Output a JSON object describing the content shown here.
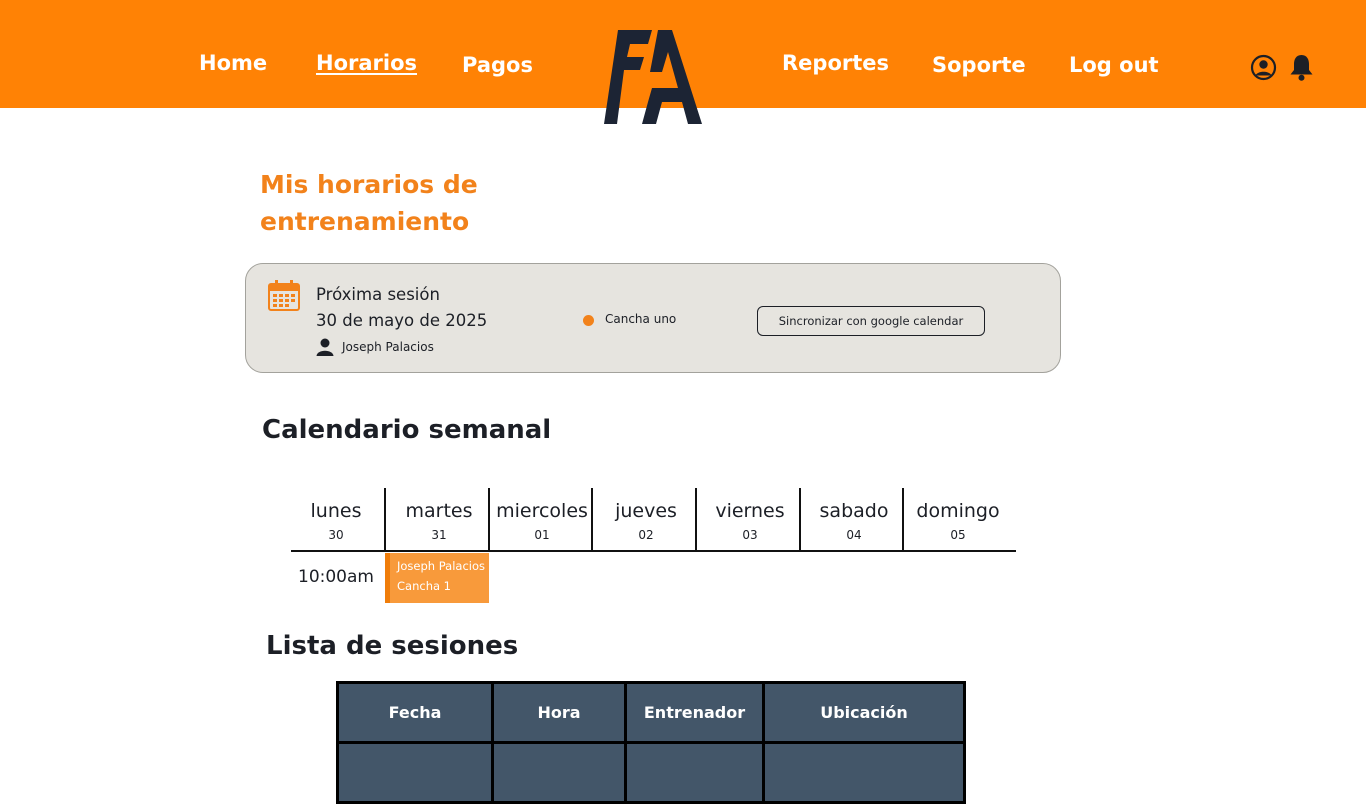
{
  "nav": {
    "home": "Home",
    "horarios": "Horarios",
    "pagos": "Pagos",
    "reportes": "Reportes",
    "soporte": "Soporte",
    "logout": "Log out"
  },
  "page": {
    "title": "Mis horarios de entrenamiento"
  },
  "next_session": {
    "label": "Próxima sesión",
    "date": "30 de mayo de 2025",
    "coach": "Joseph Palacios",
    "location": "Cancha uno",
    "sync_button": "Sincronizar con google calendar"
  },
  "calendar": {
    "title": "Calendario semanal",
    "days": [
      {
        "name": "lunes",
        "num": "30"
      },
      {
        "name": "martes",
        "num": "31"
      },
      {
        "name": "miercoles",
        "num": "01"
      },
      {
        "name": "jueves",
        "num": "02"
      },
      {
        "name": "viernes",
        "num": "03"
      },
      {
        "name": "sabado",
        "num": "04"
      },
      {
        "name": "domingo",
        "num": "05"
      }
    ],
    "time_slot": "10:00am",
    "event": {
      "coach": "Joseph Palacios",
      "location": "Cancha 1"
    }
  },
  "sessions": {
    "title": "Lista de sesiones",
    "columns": [
      "Fecha",
      "Hora",
      "Entrenador",
      "Ubicación"
    ],
    "rows": [
      [
        "",
        "",
        "",
        ""
      ]
    ]
  },
  "colors": {
    "header_bg": "#ff8205",
    "accent": "#f2821b",
    "table_header": "#435669",
    "card_bg": "#e6e4df"
  },
  "icons": {
    "user": "user-circle-icon",
    "notifications": "bell-icon",
    "calendar": "calendar-icon",
    "coach": "person-icon",
    "location": "dot-icon"
  }
}
